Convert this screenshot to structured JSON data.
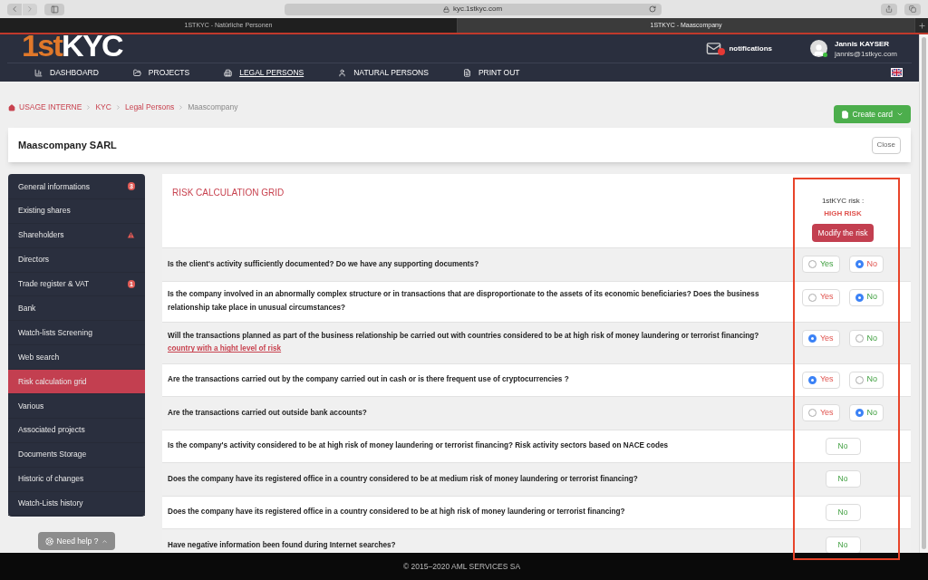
{
  "browser": {
    "url": "kyc.1stkyc.com",
    "tabs": [
      {
        "title": "1STKYC - Natürliche Personen",
        "selected": false
      },
      {
        "title": "1STKYC - Maascompany",
        "selected": true
      }
    ]
  },
  "header": {
    "logo": {
      "prefix": "1st",
      "suffix": "KYC"
    },
    "notifications": "notifications",
    "user": {
      "name": "Jannis KAYSER",
      "email": "jannis@1stkyc.com"
    },
    "nav": [
      {
        "label": "DASHBOARD",
        "selected": false
      },
      {
        "label": "PROJECTS",
        "selected": false
      },
      {
        "label": "LEGAL PERSONS",
        "selected": true
      },
      {
        "label": "NATURAL PERSONS",
        "selected": false
      },
      {
        "label": "PRINT OUT",
        "selected": false
      }
    ]
  },
  "breadcrumb": [
    "USAGE INTERNE",
    "KYC",
    "Legal Persons",
    "Maascompany"
  ],
  "create_button": "Create card",
  "card": {
    "title": "Maascompany SARL",
    "close": "Close"
  },
  "sidebar": {
    "items": [
      {
        "label": "General informations",
        "selected": false,
        "badge": {
          "kind": "count",
          "text": "3"
        }
      },
      {
        "label": "Existing shares",
        "selected": false
      },
      {
        "label": "Shareholders",
        "selected": false,
        "badge": {
          "kind": "warning"
        }
      },
      {
        "label": "Directors",
        "selected": false
      },
      {
        "label": "Trade register & VAT",
        "selected": false,
        "badge": {
          "kind": "count",
          "text": "1"
        }
      },
      {
        "label": "Bank",
        "selected": false
      },
      {
        "label": "Watch-lists Screening",
        "selected": false
      },
      {
        "label": "Web search",
        "selected": false
      },
      {
        "label": "Risk calculation grid",
        "selected": true
      },
      {
        "label": "Various",
        "selected": false
      },
      {
        "label": "Associated projects",
        "selected": false
      },
      {
        "label": "Documents Storage",
        "selected": false
      },
      {
        "label": "Historic of changes",
        "selected": false
      },
      {
        "label": "Watch-Lists history",
        "selected": false
      }
    ]
  },
  "help_button": "Need help ?",
  "grid": {
    "title": "RISK CALCULATION GRID",
    "risk_label": "1stKYC risk :",
    "risk_value": "HIGH RISK",
    "modify_button": "Modify the risk",
    "rows": [
      {
        "kind": "radio",
        "question": "Is the client's activity sufficiently documented? Do we have any supporting documents?",
        "options": [
          {
            "label": "Yes",
            "selected": false,
            "risky": false
          },
          {
            "label": "No",
            "selected": true,
            "risky": true
          }
        ]
      },
      {
        "kind": "radio",
        "question": "Is the company involved in an abnormally complex structure or in transactions that are disproportionate to the assets of its economic beneficiaries? Does the business relationship take place in unusual circumstances?",
        "options": [
          {
            "label": "Yes",
            "selected": false,
            "risky": true
          },
          {
            "label": "No",
            "selected": true,
            "risky": false
          }
        ]
      },
      {
        "kind": "radio",
        "question": "Will the transactions planned as part of the business relationship be carried out with countries considered to be at high risk of money laundering or terrorist financing?",
        "link": "country with a hight level of risk",
        "options": [
          {
            "label": "Yes",
            "selected": true,
            "risky": true
          },
          {
            "label": "No",
            "selected": false,
            "risky": false
          }
        ]
      },
      {
        "kind": "radio",
        "question": "Are the transactions carried out by the company carried out in cash or is there frequent use of cryptocurrencies ?",
        "options": [
          {
            "label": "Yes",
            "selected": true,
            "risky": true
          },
          {
            "label": "No",
            "selected": false,
            "risky": false
          }
        ]
      },
      {
        "kind": "radio",
        "question": "Are the transactions carried out outside bank accounts?",
        "options": [
          {
            "label": "Yes",
            "selected": false,
            "risky": true
          },
          {
            "label": "No",
            "selected": true,
            "risky": false
          }
        ]
      },
      {
        "kind": "value",
        "question": "Is the company's activity considered to be at high risk of money laundering or terrorist financing? Risk activity sectors based on NACE codes",
        "value": "No"
      },
      {
        "kind": "value",
        "question": "Does the company have its registered office in a country considered to be at medium risk of money laundering or terrorist financing?",
        "value": "No"
      },
      {
        "kind": "value",
        "question": "Does the company have its registered office in a country considered to be at high risk of money laundering or terrorist financing?",
        "value": "No"
      },
      {
        "kind": "value",
        "question": "Have negative information been found during Internet searches?",
        "value": "No"
      }
    ]
  },
  "footer": "© 2015–2020 AML SERVICES SA"
}
